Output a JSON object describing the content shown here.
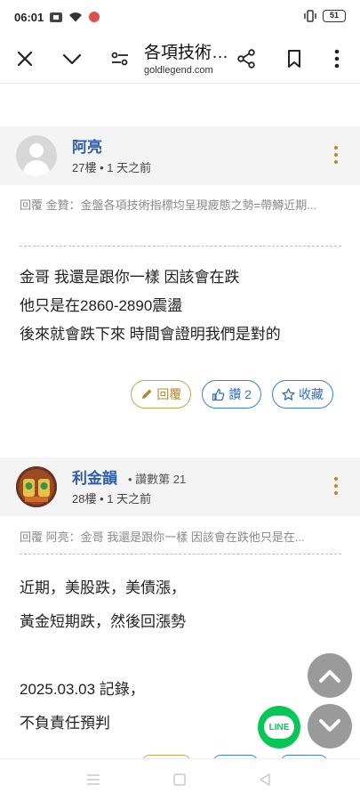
{
  "status_bar": {
    "time": "06:01",
    "battery": "51"
  },
  "toolbar": {
    "title": "各項技術…",
    "url": "goldlegend.com"
  },
  "comments": [
    {
      "author": "阿亮",
      "floor": "27樓",
      "time": "1 天之前",
      "reply_ref": "回覆 金贊：金盤各項技術指標均呈現疲態之勢=帶鱒近期...",
      "lines": [
        "金哥 我還是跟你一樣 因該會在跌",
        "他只是在2860-2890震盪",
        "後來就會跌下來 時間會證明我們是對的"
      ],
      "actions": {
        "reply": "回覆",
        "like": "讚 2",
        "favorite": "收藏"
      }
    },
    {
      "author": "利金韻",
      "author_sub": "讚數第 21",
      "floor": "28樓",
      "time": "1 天之前",
      "reply_ref": "回覆 阿亮：金哥 我還是跟你一樣 因該會在跌他只是在...",
      "lines": [
        "近期，美股跌，美債漲，",
        "黃金短期跌，然後回漲勢",
        "",
        "2025.03.03  記錄，",
        "不負責任預判"
      ]
    }
  ],
  "line_button": "LINE",
  "colors": {
    "author": "#2f5ea8",
    "reply_accent": "#c9a24a",
    "like_accent": "#3b7fd6",
    "line_green": "#06c755"
  }
}
